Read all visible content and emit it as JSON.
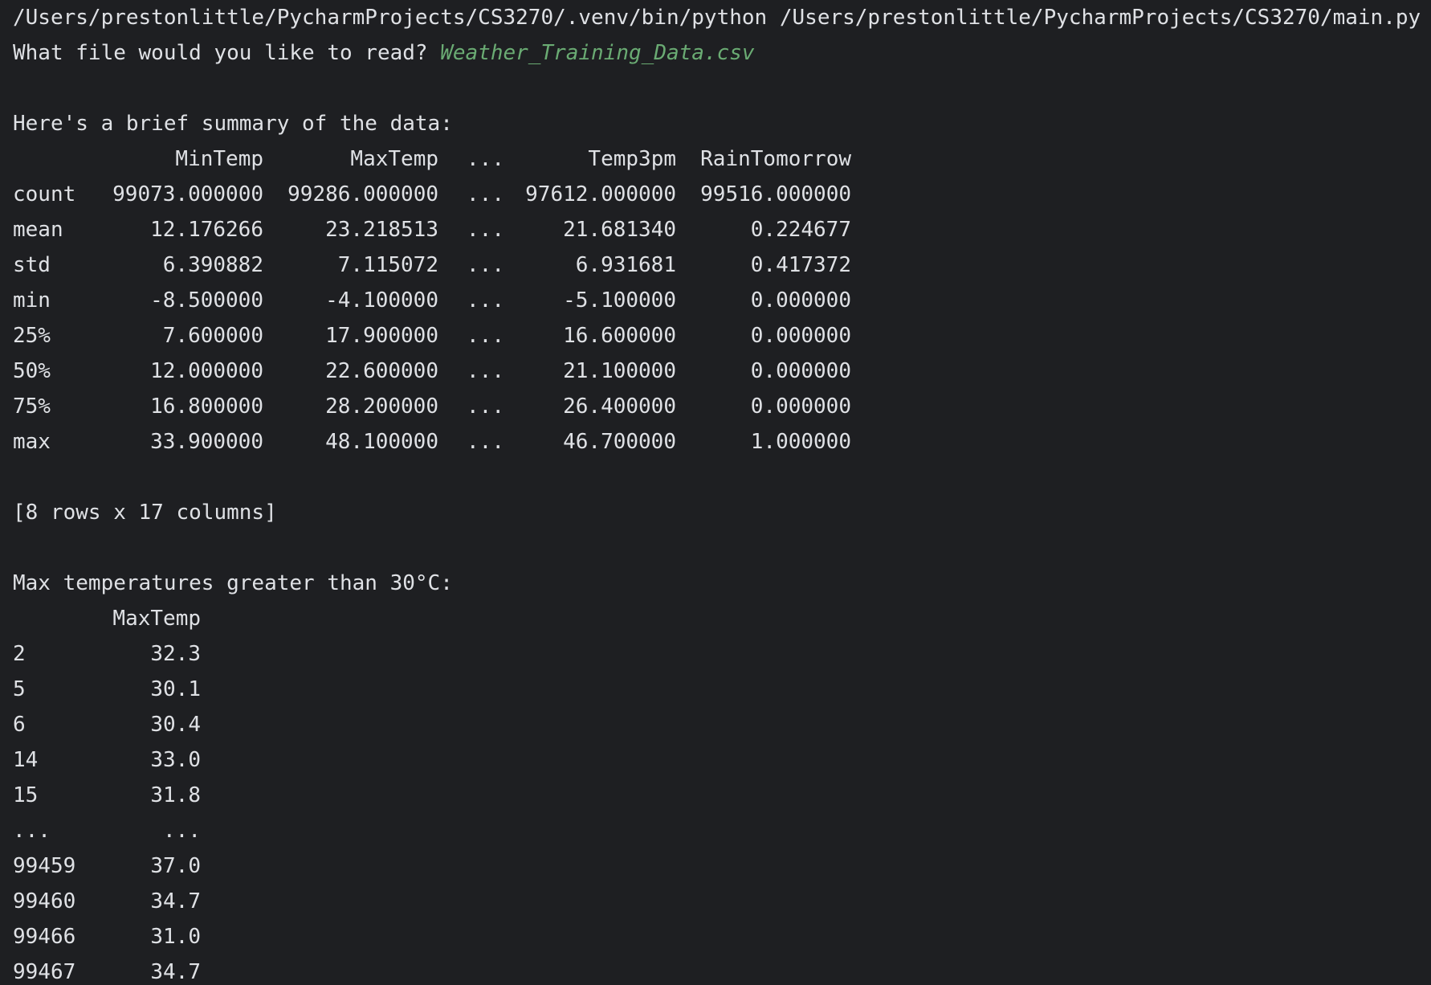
{
  "console": {
    "command_line": "/Users/prestonlittle/PycharmProjects/CS3270/.venv/bin/python /Users/prestonlittle/PycharmProjects/CS3270/main.py",
    "prompt_text": "What file would you like to read? ",
    "prompt_input": "Weather_Training_Data.csv",
    "summary_heading": "Here's a brief summary of the data:",
    "summary_table": {
      "columns": [
        "",
        "MinTemp",
        "MaxTemp",
        "...",
        "Temp3pm",
        "RainTomorrow"
      ],
      "rows": [
        [
          "count",
          "99073.000000",
          "99286.000000",
          "...",
          "97612.000000",
          "99516.000000"
        ],
        [
          "mean",
          "12.176266",
          "23.218513",
          "...",
          "21.681340",
          "0.224677"
        ],
        [
          "std",
          "6.390882",
          "7.115072",
          "...",
          "6.931681",
          "0.417372"
        ],
        [
          "min",
          "-8.500000",
          "-4.100000",
          "...",
          "-5.100000",
          "0.000000"
        ],
        [
          "25%",
          "7.600000",
          "17.900000",
          "...",
          "16.600000",
          "0.000000"
        ],
        [
          "50%",
          "12.000000",
          "22.600000",
          "...",
          "21.100000",
          "0.000000"
        ],
        [
          "75%",
          "16.800000",
          "28.200000",
          "...",
          "26.400000",
          "0.000000"
        ],
        [
          "max",
          "33.900000",
          "48.100000",
          "...",
          "46.700000",
          "1.000000"
        ]
      ]
    },
    "shape_line": "[8 rows x 17 columns]",
    "filter_heading": "Max temperatures greater than 30°C:",
    "filter_table": {
      "columns": [
        "",
        "MaxTemp"
      ],
      "rows": [
        [
          "2",
          "32.3"
        ],
        [
          "5",
          "30.1"
        ],
        [
          "6",
          "30.4"
        ],
        [
          "14",
          "33.0"
        ],
        [
          "15",
          "31.8"
        ],
        [
          "...",
          "..."
        ],
        [
          "99459",
          "37.0"
        ],
        [
          "99460",
          "34.7"
        ],
        [
          "99466",
          "31.0"
        ],
        [
          "99467",
          "34.7"
        ]
      ]
    },
    "colors": {
      "background": "#1e1f22",
      "text": "#dfe1e5",
      "user_input": "#6aab73"
    }
  }
}
